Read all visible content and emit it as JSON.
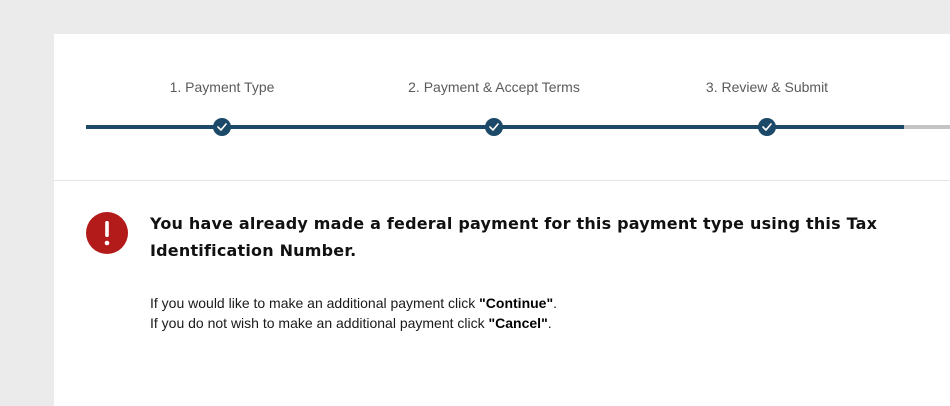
{
  "steps": [
    {
      "label": "1. Payment Type",
      "completed": true
    },
    {
      "label": "2. Payment & Accept Terms",
      "completed": true
    },
    {
      "label": "3. Review & Submit",
      "completed": true
    }
  ],
  "alert": {
    "icon": "exclamation-circle-icon",
    "color": "#b31b1b",
    "headline": "You have already made a federal payment for this payment type using this Tax Identification Number.",
    "line1_prefix": "If you would like to make an additional payment click ",
    "line1_action": "\"Continue\"",
    "line1_suffix": ".",
    "line2_prefix": "If you do not wish to make an additional payment click ",
    "line2_action": "\"Cancel\"",
    "line2_suffix": "."
  },
  "colors": {
    "progress": "#1d4968",
    "progress_remaining": "#c4c4c4",
    "background": "#ebebeb"
  }
}
